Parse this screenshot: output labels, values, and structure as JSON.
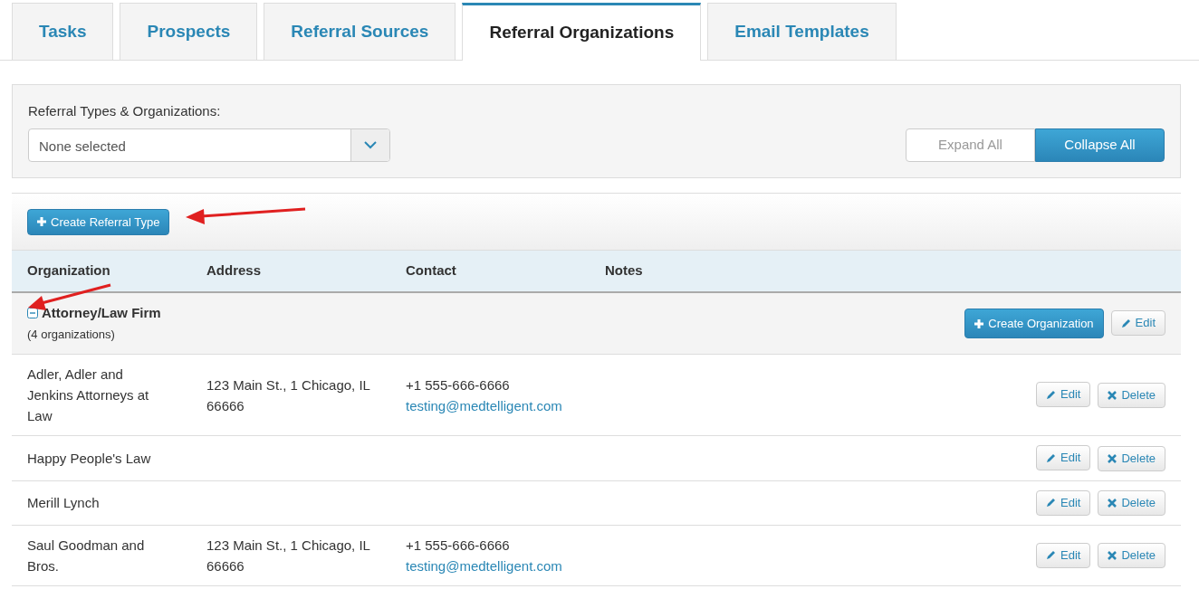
{
  "tabs": [
    {
      "label": "Tasks",
      "selected": false
    },
    {
      "label": "Prospects",
      "selected": false
    },
    {
      "label": "Referral Sources",
      "selected": false
    },
    {
      "label": "Referral Organizations",
      "selected": true
    },
    {
      "label": "Email Templates",
      "selected": false
    }
  ],
  "filter": {
    "label": "Referral Types & Organizations:",
    "value": "None selected"
  },
  "view_toggle": [
    {
      "label": "Expand All",
      "selected": false
    },
    {
      "label": "Collapse All",
      "selected": true
    }
  ],
  "create_type_button": "Create Referral Type",
  "table": {
    "columns": [
      "Organization",
      "Address",
      "Contact",
      "Notes"
    ],
    "groups": [
      {
        "name": "Attorney/Law Firm",
        "count": "(4 organizations)",
        "expanded": true,
        "create_button": "Create Organization",
        "edit_button": "Edit",
        "rows": [
          {
            "organization": "Adler, Adler and Jenkins Attorneys at Law",
            "address": "123 Main St., 1 Chicago, IL 66666",
            "phone": "+1 555-666-6666",
            "email": "testing@medtelligent.com",
            "edit": "Edit",
            "delete": "Delete"
          },
          {
            "organization": "Happy People's Law",
            "edit": "Edit",
            "delete": "Delete"
          },
          {
            "organization": "Merill Lynch",
            "edit": "Edit",
            "delete": "Delete"
          },
          {
            "organization": "Saul Goodman and Bros.",
            "address": "123 Main St., 1 Chicago, IL 66666",
            "phone": "+1 555-666-6666",
            "email": "testing@medtelligent.com",
            "edit": "Edit",
            "delete": "Delete"
          }
        ]
      }
    ]
  }
}
